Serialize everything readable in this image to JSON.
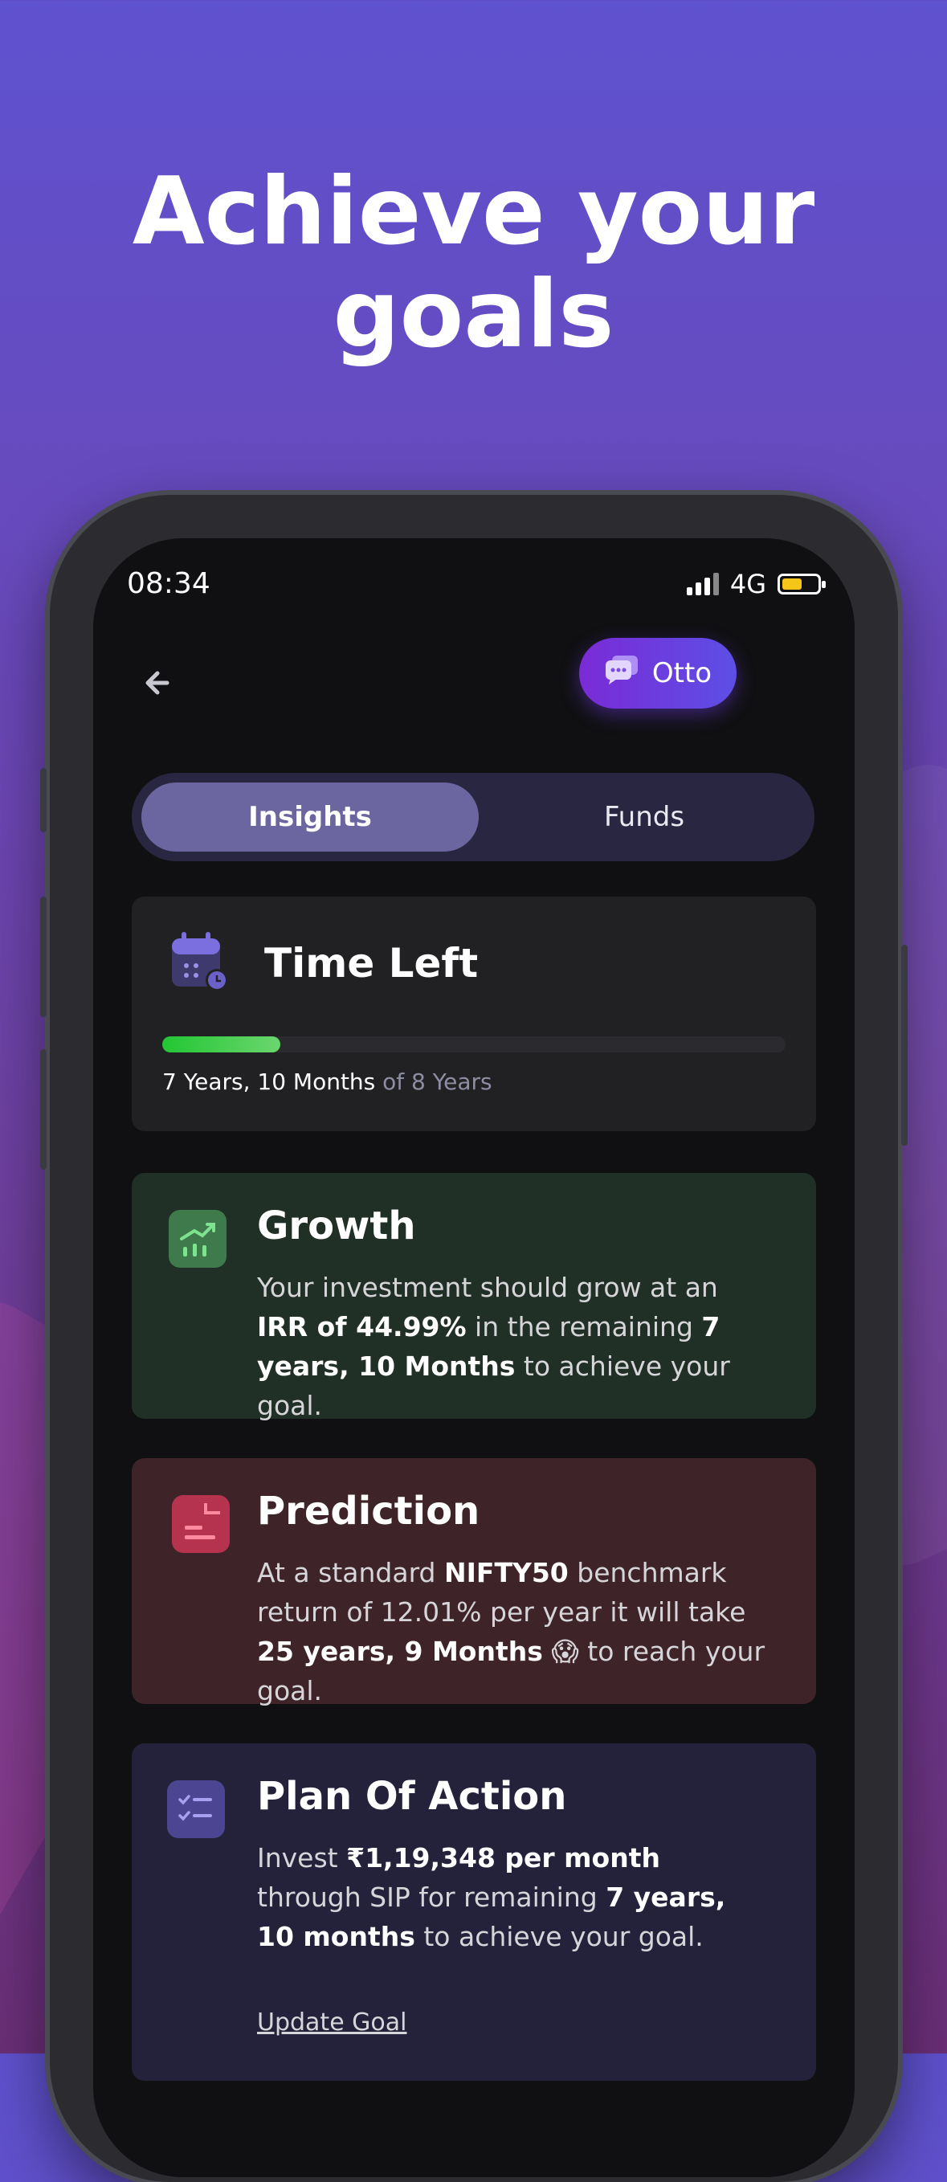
{
  "headline": {
    "line1": "Achieve your",
    "line2": "goals"
  },
  "status_bar": {
    "time": "08:34",
    "network": "4G",
    "battery_color": "#f5c518"
  },
  "header": {
    "otto_label": "Otto"
  },
  "tabs": [
    {
      "label": "Insights",
      "active": true
    },
    {
      "label": "Funds",
      "active": false
    }
  ],
  "time_left": {
    "title": "Time Left",
    "progress_fraction": 0.19,
    "remaining": "7 Years, 10 Months",
    "total": "of 8 Years"
  },
  "growth": {
    "title": "Growth",
    "t1": "Your investment should grow at an ",
    "b1": "IRR of 44.99%",
    "t2": " in the remaining ",
    "b2": "7 years, 10 Months",
    "t3": " to achieve your goal."
  },
  "prediction": {
    "title": "Prediction",
    "t1": "At a standard ",
    "b1": "NIFTY50",
    "t2": " benchmark return of 12.01% per year it will take ",
    "b2": "25 years, 9 Months",
    "emoji": "😱",
    "t3": " to reach your goal."
  },
  "plan": {
    "title": "Plan Of Action",
    "t1": "Invest ",
    "b1": "₹1,19,348 per month",
    "t2": " through SIP for remaining ",
    "b2": "7 years, 10 months",
    "t3": " to achieve your goal.",
    "link": "Update Goal"
  },
  "colors": {
    "accent": "#6b66a0",
    "progress": "#22c633",
    "growth_icon": "#3f7a4c",
    "prediction_icon": "#b5334f",
    "plan_icon": "#4c4592"
  }
}
